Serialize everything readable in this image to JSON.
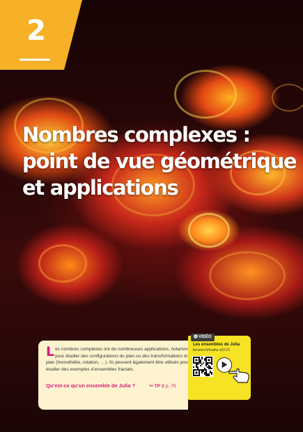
{
  "chapter": {
    "number": "2"
  },
  "title": {
    "line1": "Nombres complexes :",
    "line2": "point de vue géométrique",
    "line3": "et applications"
  },
  "intro": {
    "dropcap": "L",
    "text": "es nombres complexes ont de nombreuses applications, notamment pour étudier des configurations du plan ou des transformations du plan (homothétie, rotation, …). Ils peuvent également être utilisés pour étudier des exemples d’ensembles fractals.",
    "question": "Qu’est-ce qu’un ensemble de Julia ?",
    "tp_arrow": "↬",
    "tp_label": "TP 2",
    "tp_page": " p. 75"
  },
  "video": {
    "badge_icon": "play-circle-icon",
    "badge": "VIDÉO",
    "title": "Les ensembles de Julia",
    "url": "lienmini.fr/maths-s02-01"
  },
  "colors": {
    "tab": "#f6b128",
    "accent": "#d81b7a",
    "intro_bg": "#fdf4cf",
    "video_bg": "#f5e324"
  }
}
